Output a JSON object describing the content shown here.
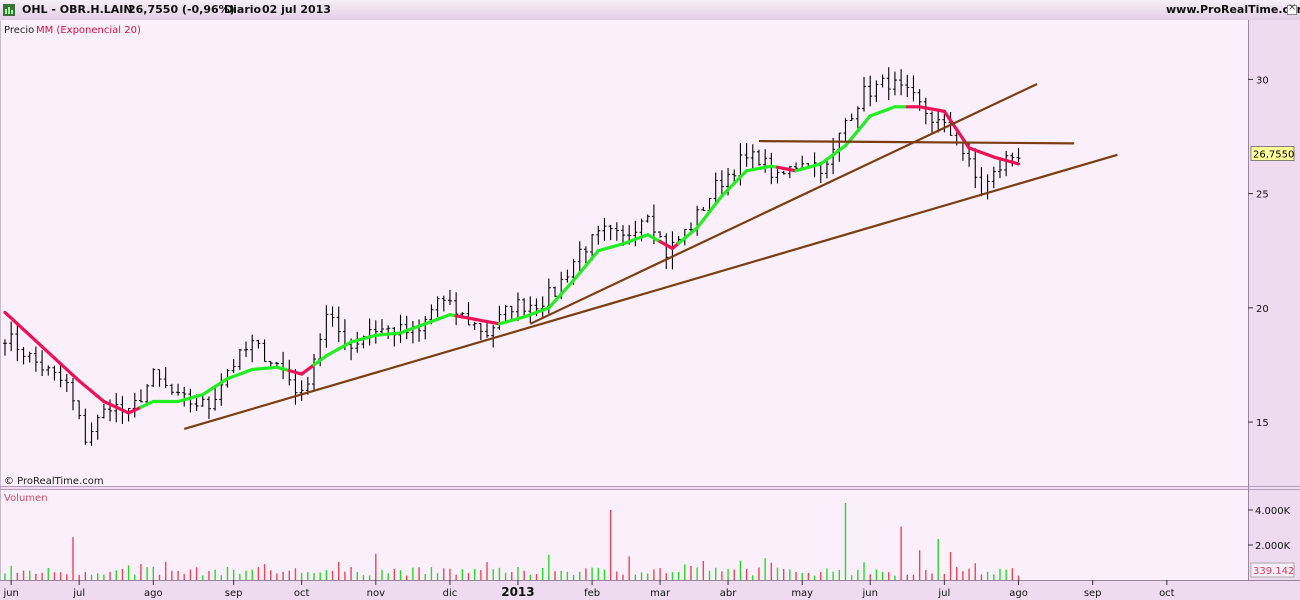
{
  "header": {
    "symbol": "OHL - OBR.H.LAIN",
    "last": "26,7550 (-0,96%)",
    "period": "Diario",
    "date": "02 jul 2013",
    "site": "www.ProRealTime.com"
  },
  "chart_data": {
    "type": "candlestick",
    "price_panel": {
      "label_precio": "Precio",
      "label_ma": "MM (Exponencial 20)",
      "copyright": "© ProRealTime.com",
      "y_ticks": [
        30,
        25,
        20,
        15
      ],
      "y_range": [
        12.2,
        32.6
      ],
      "last_value_label": "26,7550",
      "last_value": 26.755,
      "colors": {
        "ma_up": "#22ee22",
        "ma_down": "#ee1155",
        "trendline": "#7a3e10",
        "bar": "#000000"
      },
      "close_anchors": [
        [
          0,
          18.8
        ],
        [
          5,
          17.6
        ],
        [
          10,
          16.6
        ],
        [
          13,
          14.3
        ],
        [
          17,
          15.8
        ],
        [
          20,
          15.3
        ],
        [
          24,
          17.0
        ],
        [
          28,
          16.0
        ],
        [
          33,
          15.7
        ],
        [
          36,
          17.3
        ],
        [
          40,
          18.4
        ],
        [
          45,
          17.3
        ],
        [
          48,
          16.1
        ],
        [
          52,
          19.6
        ],
        [
          56,
          18.3
        ],
        [
          59,
          19.1
        ],
        [
          63,
          19.0
        ],
        [
          67,
          18.9
        ],
        [
          70,
          20.4
        ],
        [
          74,
          19.6
        ],
        [
          78,
          18.9
        ],
        [
          82,
          20.1
        ],
        [
          86,
          20.2
        ],
        [
          89,
          20.7
        ],
        [
          93,
          22.5
        ],
        [
          97,
          23.3
        ],
        [
          100,
          23.0
        ],
        [
          104,
          24.3
        ],
        [
          107,
          22.4
        ],
        [
          111,
          23.6
        ],
        [
          115,
          25.3
        ],
        [
          119,
          26.4
        ],
        [
          122,
          26.6
        ],
        [
          125,
          25.6
        ],
        [
          129,
          26.5
        ],
        [
          133,
          26.1
        ],
        [
          136,
          28.2
        ],
        [
          139,
          29.4
        ],
        [
          143,
          29.9
        ],
        [
          147,
          29.1
        ],
        [
          150,
          28.3
        ],
        [
          154,
          27.4
        ],
        [
          158,
          25.1
        ],
        [
          162,
          26.5
        ],
        [
          164,
          26.76
        ]
      ],
      "ma_anchors": [
        [
          0,
          19.8
        ],
        [
          4,
          18.8
        ],
        [
          8,
          17.8
        ],
        [
          12,
          16.8
        ],
        [
          16,
          15.9
        ],
        [
          20,
          15.4
        ],
        [
          24,
          15.9
        ],
        [
          28,
          15.9
        ],
        [
          32,
          16.2
        ],
        [
          36,
          16.9
        ],
        [
          40,
          17.3
        ],
        [
          44,
          17.4
        ],
        [
          48,
          17.1
        ],
        [
          52,
          17.9
        ],
        [
          56,
          18.5
        ],
        [
          60,
          18.8
        ],
        [
          64,
          18.9
        ],
        [
          68,
          19.3
        ],
        [
          72,
          19.7
        ],
        [
          76,
          19.5
        ],
        [
          80,
          19.3
        ],
        [
          84,
          19.6
        ],
        [
          88,
          20.0
        ],
        [
          92,
          21.2
        ],
        [
          96,
          22.5
        ],
        [
          100,
          22.8
        ],
        [
          104,
          23.2
        ],
        [
          108,
          22.6
        ],
        [
          112,
          23.5
        ],
        [
          116,
          24.9
        ],
        [
          120,
          26.0
        ],
        [
          124,
          26.2
        ],
        [
          128,
          26.0
        ],
        [
          132,
          26.3
        ],
        [
          136,
          27.1
        ],
        [
          140,
          28.4
        ],
        [
          144,
          28.8
        ],
        [
          148,
          28.8
        ],
        [
          152,
          28.6
        ],
        [
          156,
          27.0
        ],
        [
          160,
          26.6
        ],
        [
          164,
          26.3
        ]
      ],
      "ma_down_ranges": [
        [
          0,
          22
        ],
        [
          46,
          50
        ],
        [
          73,
          80
        ],
        [
          106,
          109
        ],
        [
          125,
          128
        ],
        [
          146,
          164
        ]
      ],
      "trendlines": [
        {
          "from": [
            29,
            14.7
          ],
          "to": [
            180,
            26.7
          ]
        },
        {
          "from": [
            85,
            19.3
          ],
          "to": [
            167,
            29.8
          ]
        },
        {
          "from": [
            122,
            27.3
          ],
          "to": [
            173,
            27.2
          ]
        }
      ]
    },
    "volume_panel": {
      "label": "Volumen",
      "y_ticks": [
        "4.000K",
        "2.000K"
      ],
      "y_tick_values": [
        4000,
        2000
      ],
      "y_max": 5200,
      "last_value_label": "339.142",
      "colors": {
        "up": "#22dd22",
        "down": "#ee4455"
      },
      "spikes": [
        [
          11,
          2450
        ],
        [
          60,
          1500
        ],
        [
          88,
          1450
        ],
        [
          98,
          4000
        ],
        [
          101,
          1350
        ],
        [
          119,
          1100
        ],
        [
          123,
          1250
        ],
        [
          136,
          4400
        ],
        [
          145,
          3050
        ],
        [
          148,
          1700
        ],
        [
          151,
          2350
        ],
        [
          153,
          1600
        ]
      ]
    },
    "x_ticks": [
      {
        "label": "jun",
        "bar": 1
      },
      {
        "label": "jul",
        "bar": 12
      },
      {
        "label": "ago",
        "bar": 24
      },
      {
        "label": "sep",
        "bar": 37
      },
      {
        "label": "oct",
        "bar": 48
      },
      {
        "label": "nov",
        "bar": 60
      },
      {
        "label": "dic",
        "bar": 72
      },
      {
        "label": "2013",
        "bar": 83,
        "bold": true
      },
      {
        "label": "feb",
        "bar": 95
      },
      {
        "label": "mar",
        "bar": 106
      },
      {
        "label": "abr",
        "bar": 117
      },
      {
        "label": "may",
        "bar": 129
      },
      {
        "label": "jun",
        "bar": 140
      },
      {
        "label": "jul",
        "bar": 152
      },
      {
        "label": "ago",
        "bar": 164
      },
      {
        "label": "sep",
        "bar": 176
      },
      {
        "label": "oct",
        "bar": 188
      }
    ]
  }
}
